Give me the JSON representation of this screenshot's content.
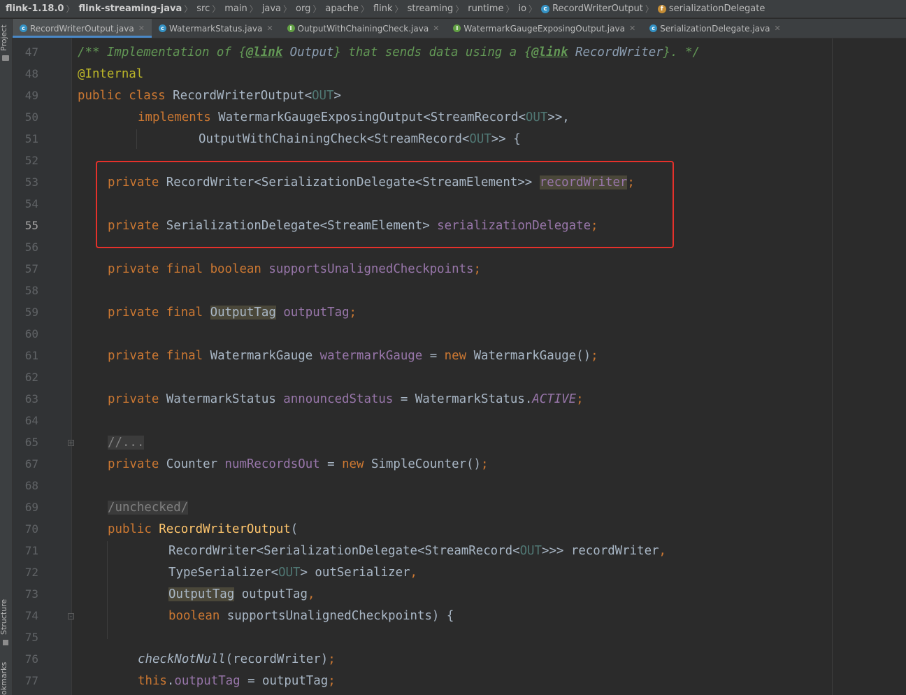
{
  "breadcrumb": [
    {
      "label": "flink-1.18.0",
      "bold": true
    },
    {
      "label": "flink-streaming-java",
      "bold": true
    },
    {
      "label": "src"
    },
    {
      "label": "main"
    },
    {
      "label": "java"
    },
    {
      "label": "org"
    },
    {
      "label": "apache"
    },
    {
      "label": "flink"
    },
    {
      "label": "streaming"
    },
    {
      "label": "runtime"
    },
    {
      "label": "io"
    },
    {
      "label": "RecordWriterOutput",
      "icon": "class-icon"
    },
    {
      "label": "serializationDelegate",
      "icon": "field-icon"
    }
  ],
  "left_strip": {
    "project": "Project",
    "structure": "Structure",
    "bookmarks": "okmarks"
  },
  "tabs": [
    {
      "label": "RecordWriterOutput.java",
      "icon": "class-icon",
      "active": true
    },
    {
      "label": "WatermarkStatus.java",
      "icon": "class-icon"
    },
    {
      "label": "OutputWithChainingCheck.java",
      "icon": "interface-icon"
    },
    {
      "label": "WatermarkGaugeExposingOutput.java",
      "icon": "interface-icon"
    },
    {
      "label": "SerializationDelegate.java",
      "icon": "class-icon"
    }
  ],
  "line_numbers": [
    "47",
    "48",
    "49",
    "50",
    "51",
    "52",
    "53",
    "54",
    "55",
    "56",
    "57",
    "58",
    "59",
    "60",
    "61",
    "62",
    "63",
    "64",
    "65",
    "67",
    "68",
    "69",
    "70",
    "71",
    "72",
    "73",
    "74",
    "75",
    "76",
    "77"
  ],
  "current_line": "55",
  "code": {
    "l47": {
      "a": "/** Implementation of {",
      "b": "@link",
      "c": " Output",
      "d": "} that sends data using a {",
      "e": "@link",
      "f": " RecordWriter",
      "g": "}. */"
    },
    "l48": {
      "a": "@Internal"
    },
    "l49": {
      "a": "public class ",
      "b": "RecordWriterOutput<",
      "c": "OUT",
      "d": ">"
    },
    "l50": {
      "a": "implements ",
      "b": "WatermarkGaugeExposingOutput<StreamRecord<",
      "c": "OUT",
      "d": ">>,"
    },
    "l51": {
      "a": "OutputWithChainingCheck<StreamRecord<",
      "b": "OUT",
      "c": ">> {"
    },
    "l53": {
      "a": "private ",
      "b": "RecordWriter<SerializationDelegate<StreamElement>> ",
      "c": "recordWriter",
      "d": ";"
    },
    "l55": {
      "a": "private ",
      "b": "SerializationDelegate<StreamElement> ",
      "c": "serializationDelegate",
      "d": ";"
    },
    "l57": {
      "a": "private final boolean ",
      "b": "supportsUnalignedCheckpoints",
      "c": ";"
    },
    "l59": {
      "a": "private final ",
      "b": "OutputTag",
      "c": " ",
      "d": "outputTag",
      "e": ";"
    },
    "l61": {
      "a": "private final ",
      "b": "WatermarkGauge ",
      "c": "watermarkGauge",
      "d": " = ",
      "e": "new ",
      "f": "WatermarkGauge()",
      "g": ";"
    },
    "l63": {
      "a": "private ",
      "b": "WatermarkStatus ",
      "c": "announcedStatus",
      "d": " = WatermarkStatus.",
      "e": "ACTIVE",
      "f": ";"
    },
    "l65": {
      "a": "//..."
    },
    "l67": {
      "a": "private ",
      "b": "Counter ",
      "c": "numRecordsOut",
      "d": " = ",
      "e": "new ",
      "f": "SimpleCounter()",
      "g": ";"
    },
    "l69": {
      "a": "/unchecked/"
    },
    "l70": {
      "a": "public ",
      "b": "RecordWriterOutput",
      "c": "("
    },
    "l71": {
      "a": "RecordWriter<SerializationDelegate<StreamRecord<",
      "b": "OUT",
      "c": ">>> recordWriter",
      ",": ","
    },
    "l72": {
      "a": "TypeSerializer<",
      "b": "OUT",
      "c": "> outSerializer",
      ",": ","
    },
    "l73": {
      "a": "OutputTag",
      "b": " outputTag",
      ",": ","
    },
    "l74": {
      "a": "boolean ",
      "b": "supportsUnalignedCheckpoints) {"
    },
    "l76": {
      "a": "checkNotNull",
      "b": "(recordWriter)",
      ";": ";"
    },
    "l77": {
      "a": "this",
      "b": ".",
      "c": "outputTag",
      "d": " = outputTag",
      ";": ";"
    }
  }
}
